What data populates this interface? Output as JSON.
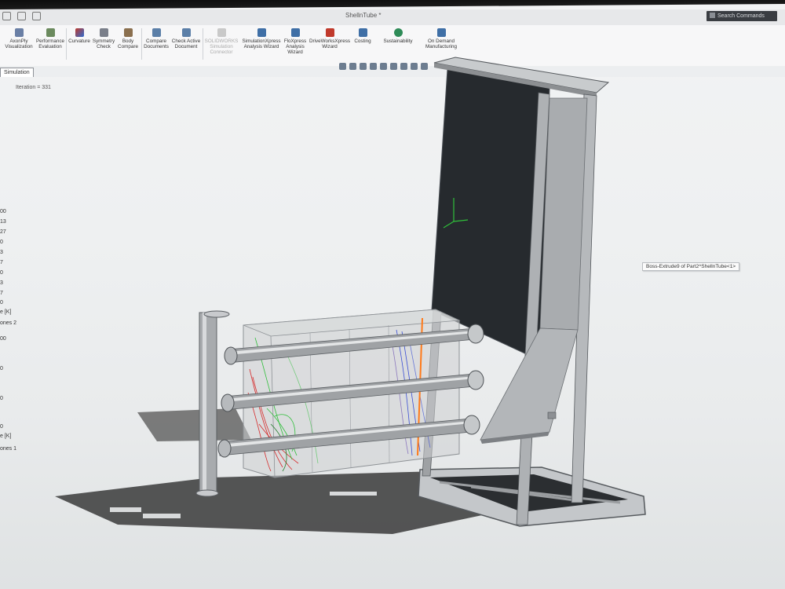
{
  "window": {
    "title": "ShellnTube *",
    "search_placeholder": "Search Commands"
  },
  "ribbon": {
    "items": [
      {
        "label": "AxonPly Visualization",
        "color": "#6a7fa5"
      },
      {
        "label": "Performance Evaluation",
        "color": "#6b8a5e"
      },
      {
        "label": "Curvature",
        "color": "#c0392b"
      },
      {
        "label": "Symmetry Check",
        "color": "#7a7f8a"
      },
      {
        "label": "Body Compare",
        "color": "#8a6f4e"
      },
      {
        "label": "Compare Documents",
        "color": "#5b7fa8"
      },
      {
        "label": "Check Active Document",
        "color": "#5b7fa8"
      },
      {
        "label": "SOLIDWORKS Simulation Connector",
        "color": "#bbbbbb"
      },
      {
        "label": "SimulationXpress Analysis Wizard",
        "color": "#3f6fa6"
      },
      {
        "label": "FloXpress Analysis Wizard",
        "color": "#3f6fa6"
      },
      {
        "label": "DriveWorksXpress Wizard",
        "color": "#c0392b"
      },
      {
        "label": "Costing",
        "color": "#3f6fa6"
      },
      {
        "label": "Sustainability",
        "color": "#2e8b57"
      },
      {
        "label": "On Demand Manufacturing",
        "color": "#3f6fa6"
      }
    ]
  },
  "tabs": {
    "active": "Simulation"
  },
  "viewport": {
    "iteration_text": "Iteration = 331",
    "left_values": [
      "00",
      "13",
      "27",
      "0",
      "3",
      "7",
      "0",
      "3",
      "7",
      "0",
      "e [K]",
      "ones 2",
      "00",
      "0",
      "0",
      "0",
      "0",
      "e [K]",
      "ones 1"
    ],
    "tooltip": "Boss-Extrude9 of Part2^ShellnTube<1>"
  },
  "colors": {
    "background": "#eef0f1",
    "frame_steel": "#b9bcbf",
    "glass_panel": "#25292e",
    "flow_red": "#d62a2a",
    "flow_green": "#2fbf3a",
    "flow_blue": "#3b4fd4",
    "flow_orange": "#ff7a1a"
  }
}
